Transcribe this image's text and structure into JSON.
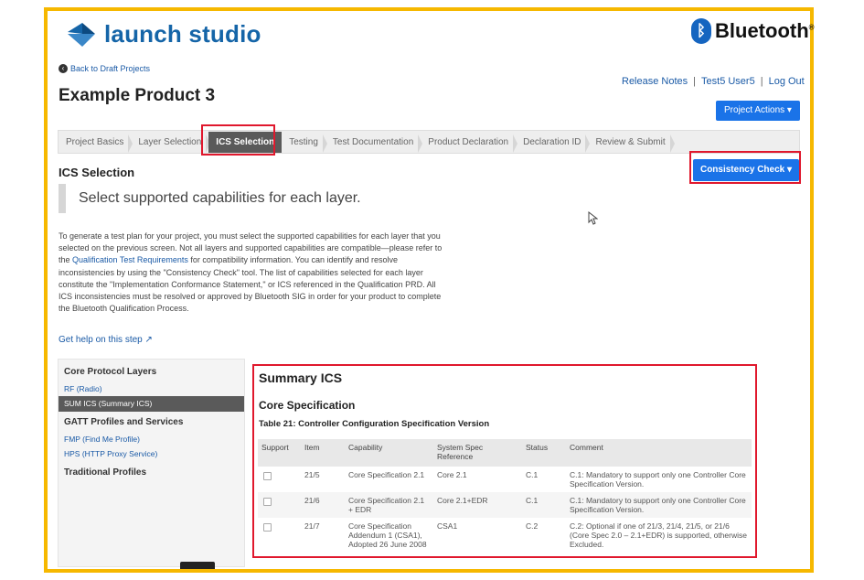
{
  "app": {
    "logo_text": "launch studio",
    "partner_logo": "Bluetooth",
    "partner_rune": "ᛒ",
    "registered_mark": "®"
  },
  "nav": {
    "back_link": "Back to Draft Projects"
  },
  "product": {
    "title": "Example Product 3"
  },
  "header_links": {
    "release_notes": "Release Notes",
    "user": "Test5 User5",
    "logout": "Log Out",
    "separator": "|"
  },
  "buttons": {
    "project_actions": "Project Actions ▾",
    "consistency_check": "Consistency Check ▾"
  },
  "steps": [
    {
      "label": "Project Basics"
    },
    {
      "label": "Layer Selection"
    },
    {
      "label": "ICS Selection",
      "active": true
    },
    {
      "label": "Testing"
    },
    {
      "label": "Test Documentation"
    },
    {
      "label": "Product Declaration"
    },
    {
      "label": "Declaration ID"
    },
    {
      "label": "Review & Submit"
    }
  ],
  "section": {
    "title": "ICS Selection",
    "callout": "Select supported capabilities for each layer.",
    "intro_before_link": "To generate a test plan for your project, you must select the supported capabilities for each layer that you selected on the previous screen. Not all layers and supported capabilities are compatible—please refer to the ",
    "intro_link": "Qualification Test Requirements",
    "intro_after_link": " for compatibility information. You can identify and resolve inconsistencies by using the \"Consistency Check\" tool. The list of capabilities selected for each layer constitute the \"Implementation Conformance Statement,\" or ICS referenced in the Qualification PRD. All ICS inconsistencies must be resolved or approved by Bluetooth SIG in order for your product to complete the Bluetooth Qualification Process.",
    "help_link": "Get help on this step",
    "external_icon": "↗"
  },
  "sidebar": {
    "groups": [
      {
        "heading": "Core Protocol Layers",
        "items": [
          {
            "label": "RF (Radio)",
            "selected": false
          },
          {
            "label": "SUM ICS (Summary ICS)",
            "selected": true
          }
        ]
      },
      {
        "heading": "GATT Profiles and Services",
        "items": [
          {
            "label": "FMP (Find Me Profile)",
            "selected": false
          },
          {
            "label": "HPS (HTTP Proxy Service)",
            "selected": false
          }
        ]
      },
      {
        "heading": "Traditional Profiles",
        "items": []
      }
    ]
  },
  "summary": {
    "title": "Summary ICS",
    "subtitle": "Core Specification",
    "table_title": "Table 21: Controller Configuration Specification Version",
    "columns": [
      "Support",
      "Item",
      "Capability",
      "System Spec Reference",
      "Status",
      "Comment"
    ],
    "rows": [
      {
        "item": "21/5",
        "capability": "Core Specification 2.1",
        "ref": "Core 2.1",
        "status": "C.1",
        "comment": "C.1: Mandatory to support only one Controller Core Specification Version."
      },
      {
        "item": "21/6",
        "capability": "Core Specification 2.1 + EDR",
        "ref": "Core 2.1+EDR",
        "status": "C.1",
        "comment": "C.1: Mandatory to support only one Controller Core Specification Version."
      },
      {
        "item": "21/7",
        "capability": "Core Specification Addendum 1 (CSA1), Adopted 26 June 2008",
        "ref": "CSA1",
        "status": "C.2",
        "comment": "C.2: Optional if one of 21/3, 21/4, 21/5, or 21/6 (Core Spec 2.0 – 2.1+EDR) is supported, otherwise Excluded."
      }
    ]
  }
}
